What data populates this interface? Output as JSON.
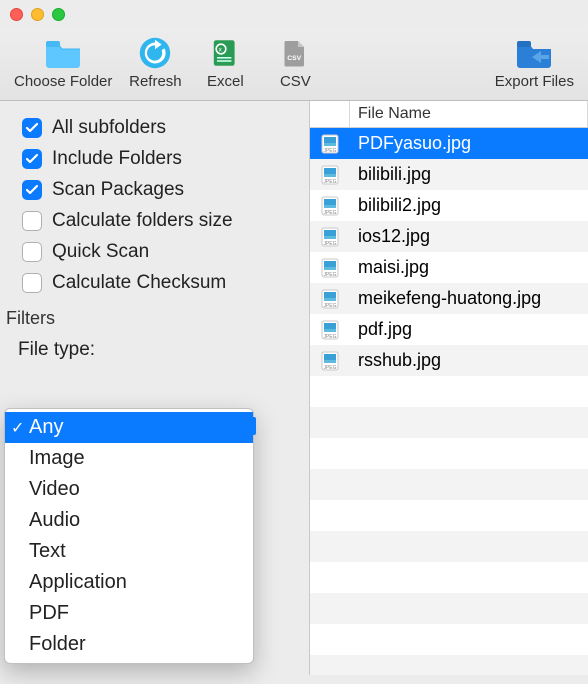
{
  "toolbar": {
    "choose_folder": "Choose Folder",
    "refresh": "Refresh",
    "excel": "Excel",
    "csv": "CSV",
    "export_files": "Export Files"
  },
  "options": {
    "all_subfolders": "All subfolders",
    "include_folders": "Include Folders",
    "scan_packages": "Scan Packages",
    "calc_folder_size": "Calculate folders size",
    "quick_scan": "Quick Scan",
    "calc_checksum": "Calculate Checksum"
  },
  "sections": {
    "filters": "Filters",
    "file_type": "File type:"
  },
  "file_type_popup": {
    "items": [
      "Any",
      "Image",
      "Video",
      "Audio",
      "Text",
      "Application",
      "PDF",
      "Folder"
    ],
    "selected_index": 0
  },
  "table": {
    "header_name": "File Name",
    "rows": [
      {
        "name": "PDFyasuo.jpg",
        "selected": true
      },
      {
        "name": "bilibili.jpg"
      },
      {
        "name": "bilibili2.jpg"
      },
      {
        "name": "ios12.jpg"
      },
      {
        "name": "maisi.jpg"
      },
      {
        "name": "meikefeng-huatong.jpg"
      },
      {
        "name": "pdf.jpg"
      },
      {
        "name": "rsshub.jpg"
      }
    ]
  }
}
